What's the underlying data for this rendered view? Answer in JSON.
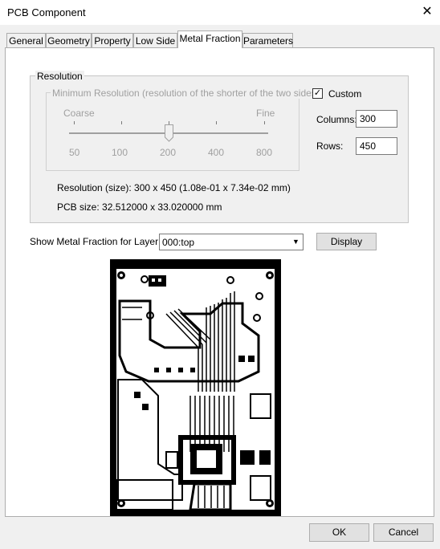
{
  "window": {
    "title": "PCB Component"
  },
  "tabs": [
    "General",
    "Geometry",
    "Property",
    "Low Side",
    "Metal Fraction",
    "Parameters"
  ],
  "active_tab": "Metal Fraction",
  "resolution": {
    "legend": "Resolution",
    "min_resolution_legend": "Minimum Resolution (resolution of the shorter of the two sides)",
    "coarse_label": "Coarse",
    "fine_label": "Fine",
    "slider_labels": [
      "50",
      "100",
      "200",
      "400",
      "800"
    ],
    "slider_value": "200",
    "custom_label": "Custom",
    "custom_checked": true,
    "columns_label": "Columns:",
    "columns_value": "300",
    "rows_label": "Rows:",
    "rows_value": "450",
    "size_text": "Resolution (size): 300 x 450 (1.08e-01 x 7.34e-02 mm)",
    "pcb_size_text": "PCB size: 32.512000 x 33.020000 mm"
  },
  "layer": {
    "label": "Show Metal Fraction for Layer",
    "selected": "000:top",
    "display_button": "Display"
  },
  "buttons": {
    "ok": "OK",
    "cancel": "Cancel"
  },
  "colors": {
    "window_bg": "#f0f0f0",
    "panel_bg": "#ffffff",
    "pcb_metal": "#000000",
    "pcb_bg": "#ffffff"
  }
}
